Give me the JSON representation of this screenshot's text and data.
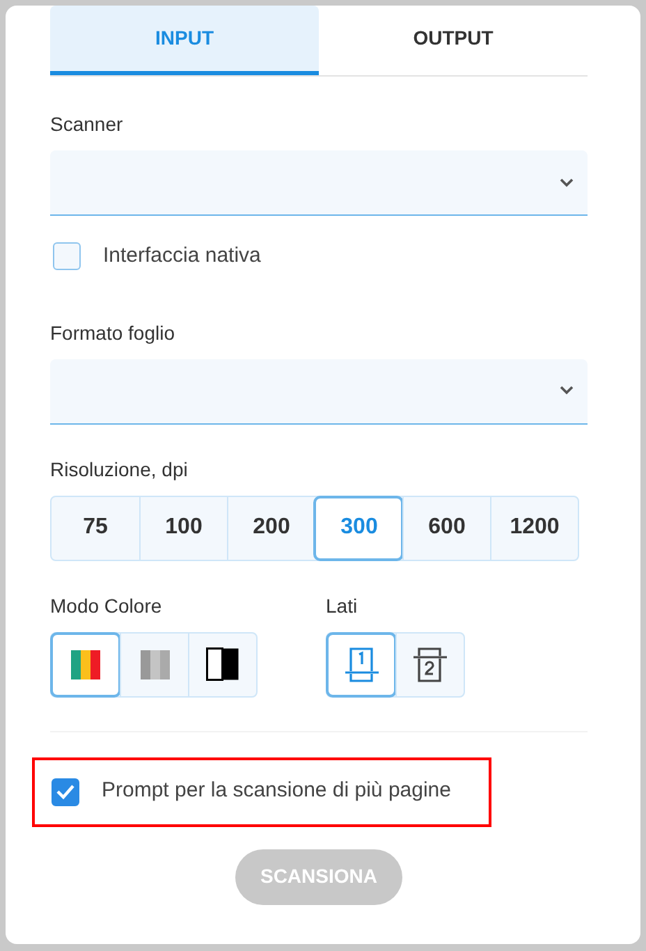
{
  "tabs": [
    {
      "label": "INPUT",
      "selected": true
    },
    {
      "label": "OUTPUT",
      "selected": false
    }
  ],
  "scanner": {
    "label": "Scanner"
  },
  "native_interface": {
    "label": "Interfaccia nativa",
    "checked": false
  },
  "paper_format": {
    "label": "Formato foglio"
  },
  "resolution": {
    "label": "Risoluzione, dpi",
    "options": [
      {
        "label": "75",
        "selected": false
      },
      {
        "label": "100",
        "selected": false
      },
      {
        "label": "200",
        "selected": false
      },
      {
        "label": "300",
        "selected": true
      },
      {
        "label": "600",
        "selected": false
      },
      {
        "label": "1200",
        "selected": false
      }
    ]
  },
  "color_mode": {
    "label": "Modo Colore",
    "options": [
      {
        "kind": "color",
        "selected": true
      },
      {
        "kind": "gray",
        "selected": false
      },
      {
        "kind": "bw",
        "selected": false
      }
    ]
  },
  "sides": {
    "label": "Lati",
    "options": [
      {
        "kind": "single",
        "selected": true
      },
      {
        "kind": "double",
        "selected": false
      }
    ]
  },
  "multipage_prompt": {
    "label": "Prompt per la scansione di più pagine",
    "checked": true,
    "highlighted": true
  },
  "scan_button": {
    "label": "SCANSIONA",
    "disabled": true
  }
}
